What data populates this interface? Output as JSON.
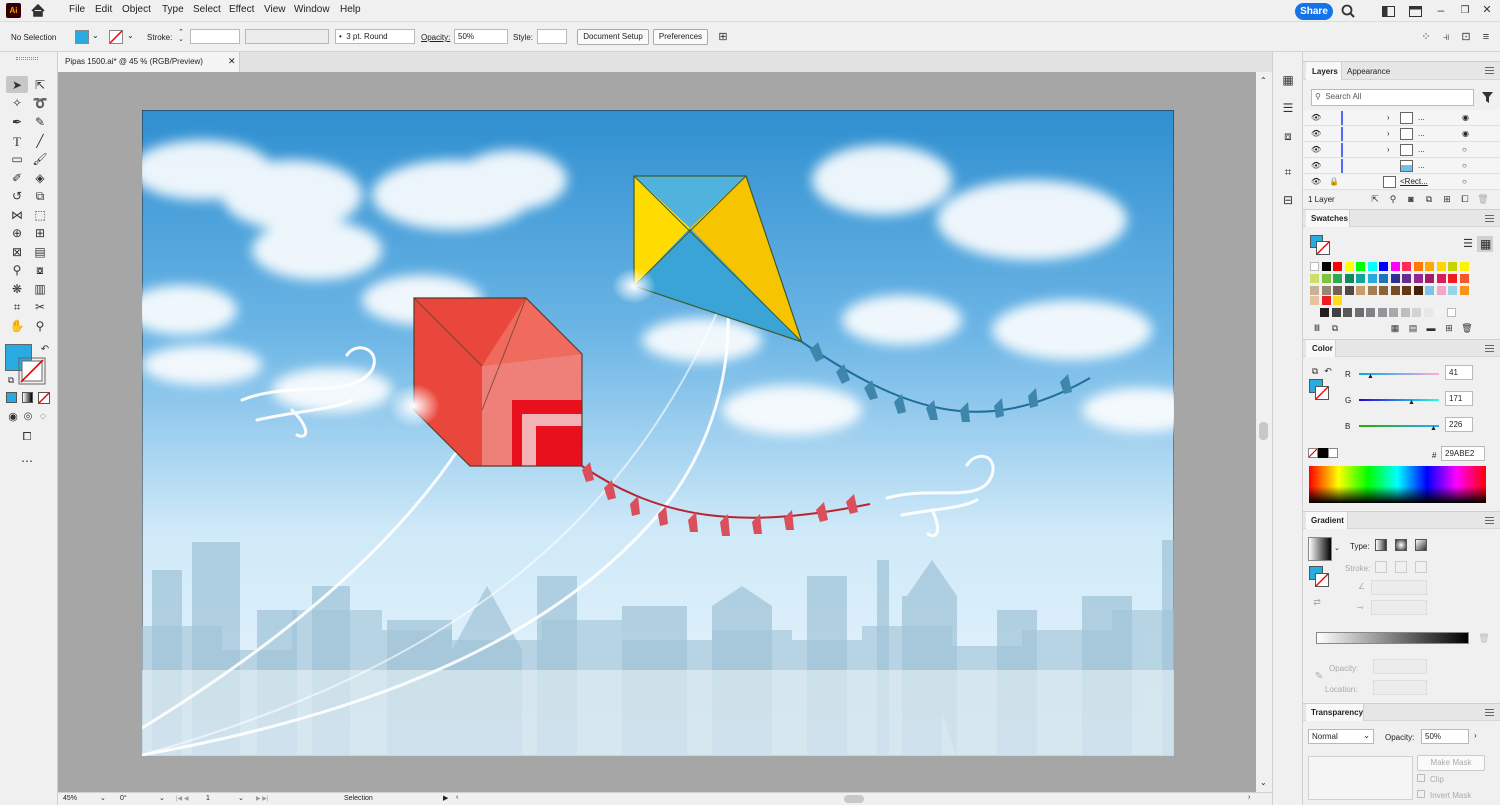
{
  "app": {
    "logo": "Ai"
  },
  "menu": [
    "File",
    "Edit",
    "Object",
    "Type",
    "Select",
    "Effect",
    "View",
    "Window",
    "Help"
  ],
  "top_right": {
    "share_label": "Share"
  },
  "control_bar": {
    "selection": "No Selection",
    "stroke_label": "Stroke:",
    "brush": "3 pt. Round",
    "opacity_label": "Opacity:",
    "opacity_value": "50%",
    "style_label": "Style:",
    "document_setup": "Document Setup",
    "preferences": "Preferences"
  },
  "document_tab": {
    "title": "Pipas 1500.ai* @ 45 % (RGB/Preview)"
  },
  "status_bar": {
    "zoom": "45%",
    "rotation": "0°",
    "artboard": "1",
    "tool": "Selection"
  },
  "layers_panel": {
    "tabs": [
      "Layers",
      "Appearance"
    ],
    "search_placeholder": "Search All",
    "rows": [
      "...",
      "...",
      "...",
      "...",
      "<Rect..."
    ],
    "count": "1 Layer"
  },
  "swatches_panel": {
    "title": "Swatches",
    "row1": [
      "#ffffff",
      "#000000",
      "#ff0000",
      "#ffff00",
      "#00ff00",
      "#00ffff",
      "#0000ff",
      "#ff00ff",
      "#ff2a55",
      "#ff7a00",
      "#ffaa00",
      "#ffd400",
      "#c8d400",
      "#fff200"
    ],
    "row2": [
      "#cde06a",
      "#7ec23f",
      "#2fa84f",
      "#0f8a5f",
      "#15a39a",
      "#27aae1",
      "#1c75bc",
      "#2e3192",
      "#662d91",
      "#92278f",
      "#9e1f63",
      "#d91c5c",
      "#ed1c24",
      "#f15a29"
    ],
    "row3": [
      "#c7b299",
      "#998675",
      "#736357",
      "#534741",
      "#c69c6d",
      "#a67c52",
      "#8c6239",
      "#754c24",
      "#603813",
      "#42210b",
      "#7fc4e8",
      "#f4a6c8",
      "#9ad2e8",
      "#f7941d"
    ],
    "row4": [
      "#e6c39a",
      "#ed1c24",
      "#ffde17"
    ],
    "row5": [
      "#231f20",
      "#414042",
      "#58595b",
      "#6d6e71",
      "#808285",
      "#939598",
      "#a7a9ac",
      "#bcbec0",
      "#d1d3d4",
      "#e6e7e8",
      "#f1f2f2",
      "#ffffff"
    ]
  },
  "color_panel": {
    "title": "Color",
    "r_label": "R",
    "r_value": "41",
    "g_label": "G",
    "g_value": "171",
    "b_label": "B",
    "b_value": "226",
    "hex_label": "#",
    "hex_value": "29ABE2"
  },
  "gradient_panel": {
    "title": "Gradient",
    "type_label": "Type:",
    "stroke_label": "Stroke:",
    "opacity_label": "Opacity:",
    "location_label": "Location:"
  },
  "transparency_panel": {
    "title": "Transparency",
    "mode": "Normal",
    "opacity_label": "Opacity:",
    "opacity_value": "50%",
    "make_mask": "Make Mask",
    "clip": "Clip",
    "invert_mask": "Invert Mask"
  },
  "colors": {
    "accent": "#29abe2",
    "share": "#1473e6"
  }
}
